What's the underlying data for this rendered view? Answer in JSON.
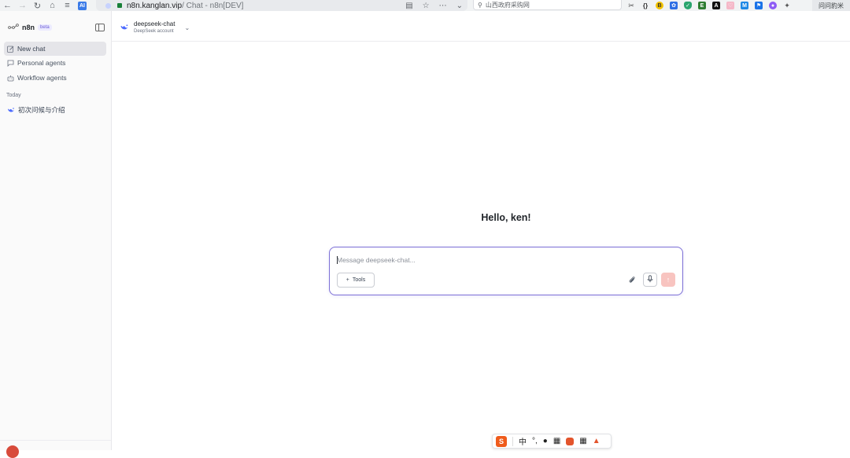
{
  "browser": {
    "url_domain": "n8n.kanglan.vip",
    "url_rest": " / Chat - n8n[DEV]",
    "search_text": "山西政府采购网",
    "profile_label": "问问豹米"
  },
  "sidebar": {
    "brand": "n8n",
    "badge": "beta",
    "nav": [
      {
        "label": "New chat",
        "icon": "edit-icon"
      },
      {
        "label": "Personal agents",
        "icon": "chat-bubble-icon"
      },
      {
        "label": "Workflow agents",
        "icon": "robot-icon"
      }
    ],
    "section_label": "Today",
    "history": [
      {
        "label": "初次问候与介绍",
        "icon": "deepseek-whale-icon"
      }
    ]
  },
  "topbar": {
    "model_name": "deepseek-chat",
    "model_account": "DeepSeek account"
  },
  "main": {
    "greeting": "Hello, ken!",
    "composer": {
      "placeholder": "Message deepseek-chat...",
      "tools_label": "Tools"
    }
  },
  "ime": {
    "mode_char": "中"
  },
  "colors": {
    "accent": "#7c6fd6",
    "send_disabled": "#f8c4c0",
    "deepseek_blue": "#4d6bfe"
  }
}
